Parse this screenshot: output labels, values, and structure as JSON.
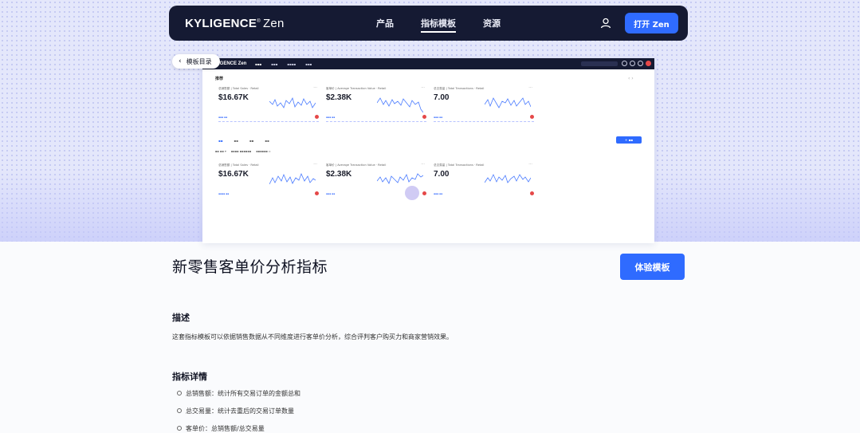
{
  "nav": {
    "logo_brand": "KYLIGENCE",
    "logo_product": "Zen",
    "links": [
      "产品",
      "指标模板",
      "资源"
    ],
    "active_link": "指标模板",
    "open_button": "打开 Zen"
  },
  "back_button": "模板目录",
  "preview": {
    "logo": "KYLIGENCE Zen",
    "section_label": "推荐",
    "cards_top": [
      {
        "title": "总销售额 | Total Sales · Retail",
        "value": "$16.67K"
      },
      {
        "title": "客单价 | Average Transaction Value · Retail",
        "value": "$2.38K"
      },
      {
        "title": "总交易量 | Total Transactions · Retail",
        "value": "7.00"
      }
    ],
    "cards_bottom": [
      {
        "title": "总销售额 | Total Sales · Retail",
        "value": "$16.67K"
      },
      {
        "title": "客单价 | Average Transaction Value · Retail",
        "value": "$2.38K"
      },
      {
        "title": "总交易量 | Total Transactions · Retail",
        "value": "7.00"
      }
    ]
  },
  "page": {
    "title": "新零售客单价分析指标",
    "try_button": "体验模板",
    "desc_heading": "描述",
    "description": "这套指标模板可以依据销售数据从不同维度进行客单价分析，综合评判客户购买力和商家营销效果。",
    "details_heading": "指标详情",
    "details": [
      "总销售额：统计所有交易订单的金额总和",
      "总交易量：统计去重后的交易订单数量",
      "客单价：总销售额/总交易量"
    ]
  },
  "colors": {
    "nav_bg": "#151a33",
    "accent": "#2f6bff",
    "hero_bg": "#e4e7fb"
  }
}
